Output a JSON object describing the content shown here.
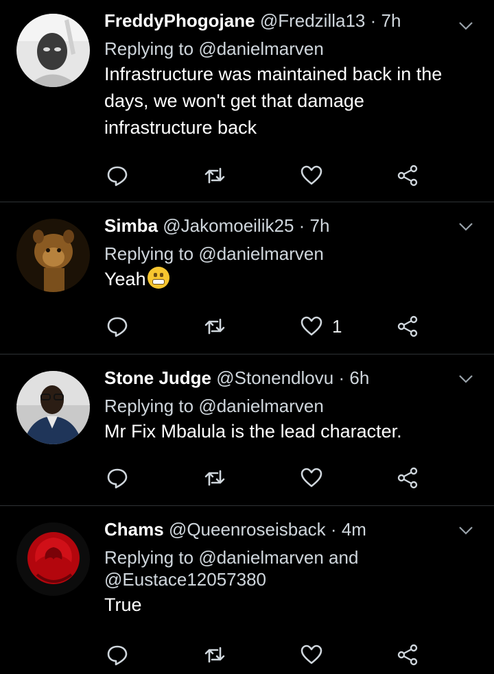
{
  "colors": {
    "background": "#000000",
    "divider": "#2f3336",
    "secondary_text": "#cfd6dc"
  },
  "tweets": [
    {
      "name": "FreddyPhogojane",
      "handle": "@Fredzilla13",
      "sep": "·",
      "time": "7h",
      "reply_prefix": "Replying to",
      "reply_to": "@danielmarven",
      "text": "Infrastructure was maintained back in the days, we won't get that damage infrastructure back",
      "avatar_icon": "user-photo-icon",
      "like_count": ""
    },
    {
      "name": "Simba",
      "handle": "@Jakomoeilik25",
      "sep": "·",
      "time": "7h",
      "reply_prefix": "Replying to",
      "reply_to": "@danielmarven",
      "text": "Yeah",
      "emoji": "grimacing-face",
      "avatar_icon": "lion-photo-icon",
      "like_count": "1"
    },
    {
      "name": "Stone Judge",
      "handle": "@Stonendlovu",
      "sep": "·",
      "time": "6h",
      "reply_prefix": "Replying to",
      "reply_to": "@danielmarven",
      "text": "Mr Fix Mbalula is the lead character.",
      "avatar_icon": "user-photo-icon",
      "like_count": ""
    },
    {
      "name": "Chams",
      "handle": "@Queenroseisback",
      "sep": "·",
      "time": "4m",
      "reply_prefix": "Replying to",
      "reply_to": "@danielmarven",
      "reply_and": "and",
      "reply_to_2": "@Eustace12057380",
      "text": "True",
      "avatar_icon": "rose-photo-icon",
      "like_count": ""
    }
  ]
}
